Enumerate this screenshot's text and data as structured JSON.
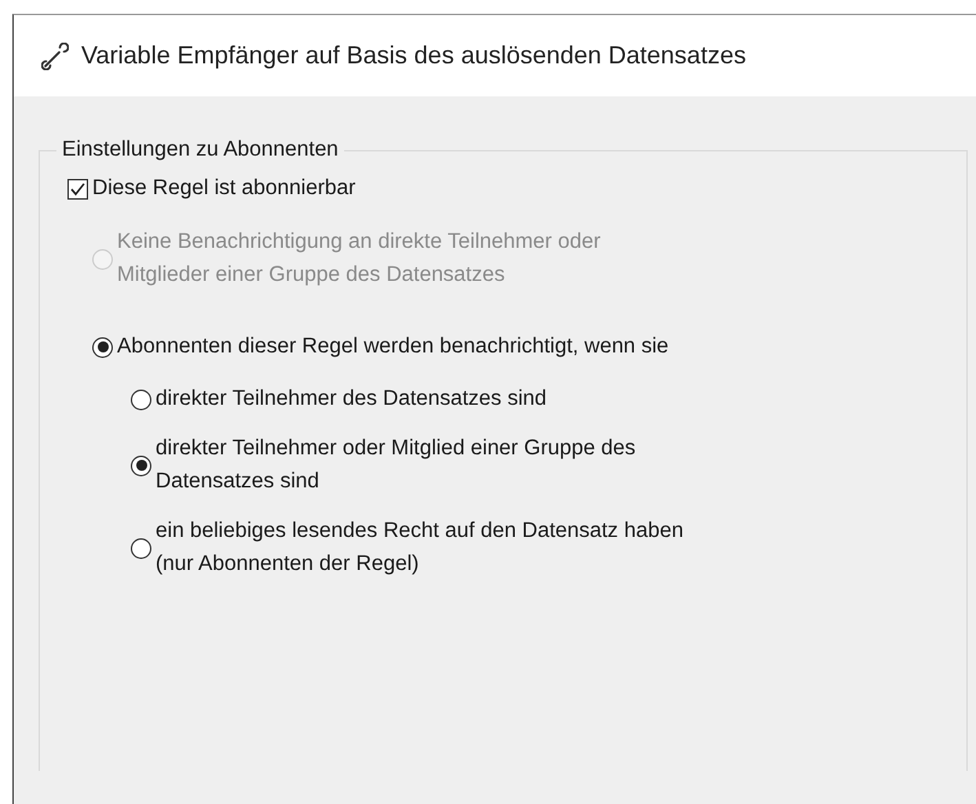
{
  "window": {
    "title": "Variable Empfänger auf Basis des auslösenden Datensatzes"
  },
  "group": {
    "label": "Einstellungen zu Abonnenten",
    "checkbox": {
      "label": "Diese Regel ist abonnierbar",
      "checked": true
    },
    "options": [
      {
        "label": "Keine Benachrichtigung an direkte Teilnehmer oder\nMitglieder einer Gruppe des Datensatzes",
        "selected": false,
        "disabled": true
      },
      {
        "label": "Abonnenten dieser Regel werden benachrichtigt, wenn sie",
        "selected": true,
        "disabled": false,
        "children": [
          {
            "label": "direkter Teilnehmer des Datensatzes sind",
            "selected": false,
            "disabled": false
          },
          {
            "label": "direkter Teilnehmer oder Mitglied einer Gruppe des\nDatensatzes sind",
            "selected": true,
            "disabled": false
          },
          {
            "label": "ein beliebiges lesendes Recht auf den Datensatz haben\n(nur Abonnenten der Regel)",
            "selected": false,
            "disabled": false
          }
        ]
      }
    ]
  }
}
